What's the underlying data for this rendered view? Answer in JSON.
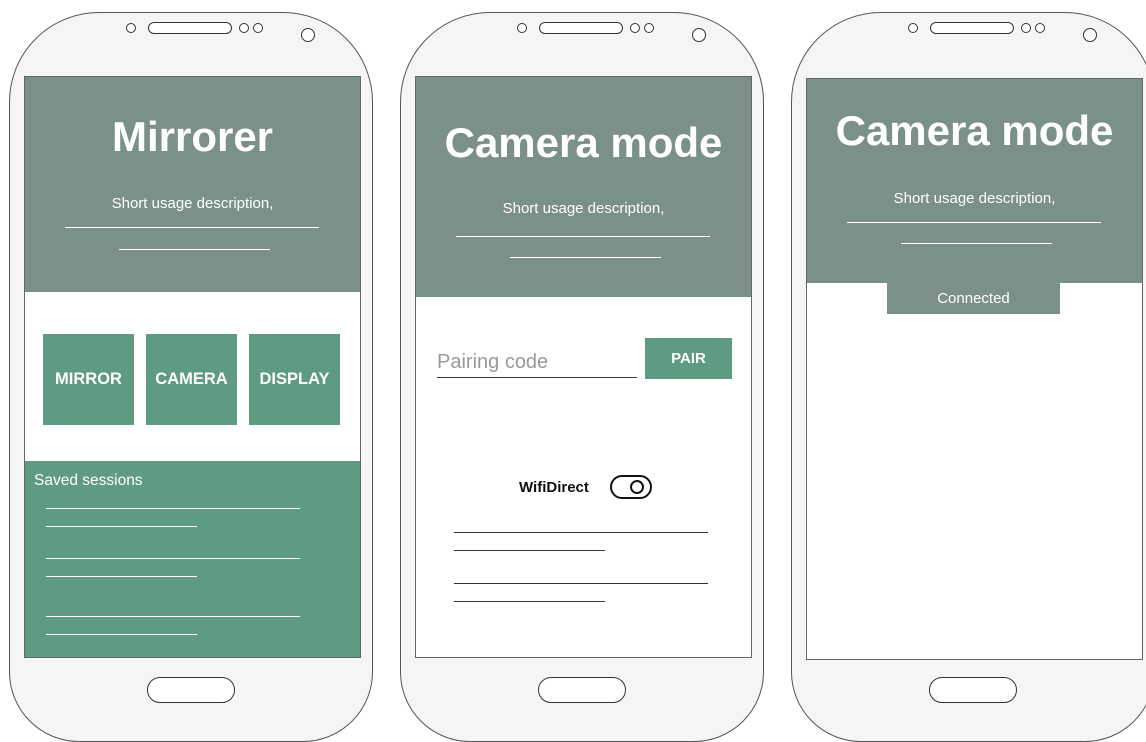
{
  "screens": [
    {
      "title": "Mirrorer",
      "description": "Short usage description,",
      "mode_buttons": [
        {
          "label": "MIRROR"
        },
        {
          "label": "CAMERA"
        },
        {
          "label": "DISPLAY"
        }
      ],
      "saved_sessions": {
        "title": "Saved sessions"
      }
    },
    {
      "title": "Camera mode",
      "description": "Short usage description,",
      "pairing": {
        "placeholder": "Pairing code",
        "value": "",
        "button_label": "PAIR"
      },
      "wifi_direct": {
        "label": "WifiDirect",
        "enabled": true
      }
    },
    {
      "title": "Camera mode",
      "description": "Short usage description,",
      "status": "Connected"
    }
  ],
  "colors": {
    "header": "#7b9188",
    "accent_green": "#5f9b80",
    "text_on_color": "#ffffff",
    "outline": "#333333"
  },
  "icons": [
    "toggle-switch-icon",
    "front-camera-icon",
    "speaker-icon",
    "home-button-icon"
  ]
}
